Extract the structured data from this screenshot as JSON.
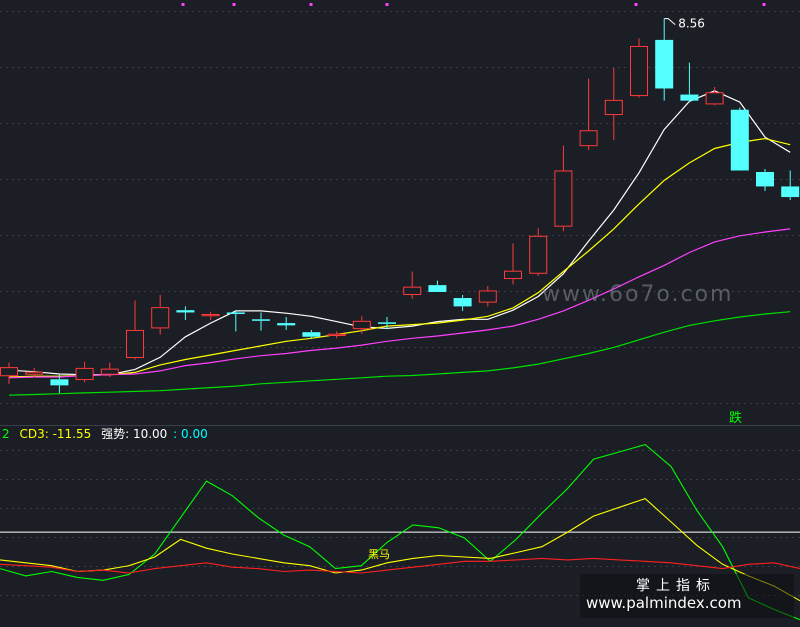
{
  "chart_data": {
    "type": "candlestick",
    "y_range": [
      3.3,
      8.7
    ],
    "high_label": "8.56",
    "candles": [
      {
        "o": 3.85,
        "c": 3.97,
        "h": 4.03,
        "l": 3.75
      },
      {
        "o": 3.87,
        "c": 3.91,
        "h": 3.96,
        "l": 3.83
      },
      {
        "o": 3.81,
        "c": 3.73,
        "h": 3.87,
        "l": 3.63
      },
      {
        "o": 3.8,
        "c": 3.96,
        "h": 4.04,
        "l": 3.77
      },
      {
        "o": 3.87,
        "c": 3.95,
        "h": 4.03,
        "l": 3.84
      },
      {
        "o": 4.09,
        "c": 4.46,
        "h": 4.85,
        "l": 4.07
      },
      {
        "o": 4.48,
        "c": 4.76,
        "h": 4.92,
        "l": 4.4
      },
      {
        "o": 4.72,
        "c": 4.69,
        "h": 4.77,
        "l": 4.59
      },
      {
        "o": 4.64,
        "c": 4.67,
        "h": 4.7,
        "l": 4.59
      },
      {
        "o": 4.69,
        "c": 4.67,
        "h": 4.72,
        "l": 4.44
      },
      {
        "o": 4.6,
        "c": 4.58,
        "h": 4.69,
        "l": 4.45
      },
      {
        "o": 4.55,
        "c": 4.52,
        "h": 4.63,
        "l": 4.46
      },
      {
        "o": 4.43,
        "c": 4.37,
        "h": 4.46,
        "l": 4.34
      },
      {
        "o": 4.38,
        "c": 4.41,
        "h": 4.44,
        "l": 4.35
      },
      {
        "o": 4.47,
        "c": 4.58,
        "h": 4.64,
        "l": 4.41
      },
      {
        "o": 4.56,
        "c": 4.54,
        "h": 4.63,
        "l": 4.47
      },
      {
        "o": 4.92,
        "c": 5.03,
        "h": 5.23,
        "l": 4.87
      },
      {
        "o": 5.05,
        "c": 4.96,
        "h": 5.11,
        "l": 4.96
      },
      {
        "o": 4.88,
        "c": 4.77,
        "h": 4.92,
        "l": 4.71
      },
      {
        "o": 4.82,
        "c": 4.98,
        "h": 5.04,
        "l": 4.77
      },
      {
        "o": 5.13,
        "c": 5.24,
        "h": 5.6,
        "l": 5.06
      },
      {
        "o": 5.2,
        "c": 5.7,
        "h": 5.8,
        "l": 5.17
      },
      {
        "o": 5.82,
        "c": 6.56,
        "h": 6.89,
        "l": 5.76
      },
      {
        "o": 6.88,
        "c": 7.09,
        "h": 7.77,
        "l": 6.83
      },
      {
        "o": 7.29,
        "c": 7.49,
        "h": 7.91,
        "l": 6.96
      },
      {
        "o": 7.54,
        "c": 8.2,
        "h": 8.3,
        "l": 7.52
      },
      {
        "o": 8.28,
        "c": 7.64,
        "h": 8.56,
        "l": 7.48
      },
      {
        "o": 7.56,
        "c": 7.48,
        "h": 7.98,
        "l": 7.46
      },
      {
        "o": 7.43,
        "c": 7.59,
        "h": 7.66,
        "l": 7.42
      },
      {
        "o": 7.36,
        "c": 6.56,
        "h": 7.39,
        "l": 6.56
      },
      {
        "o": 6.54,
        "c": 6.35,
        "h": 6.58,
        "l": 6.29
      },
      {
        "o": 6.35,
        "c": 6.21,
        "h": 6.56,
        "l": 6.17
      }
    ],
    "ma_lines": [
      {
        "color": "#ffffff",
        "values": [
          3.93,
          3.91,
          3.88,
          3.87,
          3.87,
          3.94,
          4.1,
          4.37,
          4.55,
          4.71,
          4.71,
          4.68,
          4.64,
          4.57,
          4.5,
          4.48,
          4.51,
          4.57,
          4.6,
          4.6,
          4.72,
          4.9,
          5.2,
          5.63,
          6.04,
          6.53,
          7.1,
          7.47,
          7.61,
          7.46,
          7.0,
          6.8
        ]
      },
      {
        "color": "#ffff00",
        "values": [
          3.84,
          3.85,
          3.85,
          3.86,
          3.87,
          3.9,
          4.0,
          4.07,
          4.13,
          4.19,
          4.25,
          4.31,
          4.35,
          4.4,
          4.45,
          4.51,
          4.53,
          4.55,
          4.59,
          4.64,
          4.75,
          4.95,
          5.23,
          5.5,
          5.79,
          6.12,
          6.43,
          6.66,
          6.85,
          6.93,
          6.98,
          6.9
        ]
      },
      {
        "color": "#ff40ff",
        "values": [
          3.83,
          3.84,
          3.84,
          3.86,
          3.87,
          3.88,
          3.92,
          3.99,
          4.03,
          4.08,
          4.12,
          4.15,
          4.19,
          4.22,
          4.26,
          4.31,
          4.35,
          4.38,
          4.42,
          4.46,
          4.51,
          4.6,
          4.71,
          4.85,
          5.0,
          5.16,
          5.31,
          5.48,
          5.62,
          5.7,
          5.75,
          5.79
        ]
      },
      {
        "color": "#00e000",
        "values": [
          3.6,
          3.61,
          3.62,
          3.63,
          3.64,
          3.65,
          3.66,
          3.68,
          3.7,
          3.72,
          3.75,
          3.77,
          3.79,
          3.81,
          3.83,
          3.85,
          3.86,
          3.88,
          3.9,
          3.92,
          3.96,
          4.01,
          4.08,
          4.15,
          4.23,
          4.33,
          4.43,
          4.52,
          4.58,
          4.63,
          4.67,
          4.7
        ]
      }
    ],
    "signal_label": "跌",
    "indicator": {
      "header": [
        {
          "text": "2",
          "color": "#00ff00"
        },
        {
          "text": "CD3: -11.55",
          "color": "#ffff00"
        },
        {
          "text": "强势: 10.00",
          "color": "#ffffff"
        },
        {
          "text": ": 0.00",
          "color": "#00ffff"
        }
      ],
      "y_range": [
        -30,
        105
      ],
      "reference_level": 35,
      "green_values": [
        10,
        5,
        8,
        4,
        2,
        6,
        20,
        45,
        70,
        60,
        45,
        33,
        25,
        10,
        12,
        28,
        40,
        38,
        31,
        15,
        30,
        48,
        65,
        85,
        90,
        95,
        80,
        50,
        25,
        -10,
        -18,
        -25
      ],
      "yellow_values": [
        16,
        14,
        12,
        8,
        9,
        12,
        18,
        30,
        24,
        20,
        17,
        14,
        12,
        7,
        9,
        14,
        17,
        19,
        18,
        17,
        21,
        25,
        35,
        46,
        52,
        58,
        42,
        26,
        13,
        5,
        -2,
        -12
      ],
      "red_values": [
        13,
        12,
        11,
        8,
        9,
        7,
        10,
        12,
        14,
        11,
        10,
        8,
        9,
        8,
        7,
        9,
        11,
        13,
        15,
        15,
        16,
        17,
        16,
        17,
        16,
        15,
        14,
        12,
        10,
        13,
        14,
        10
      ],
      "dark_horse_label": "黑马"
    },
    "watermark": "www.6o7o.com",
    "site_cn": "掌上指标",
    "site_url": "www.palmindex.com"
  }
}
